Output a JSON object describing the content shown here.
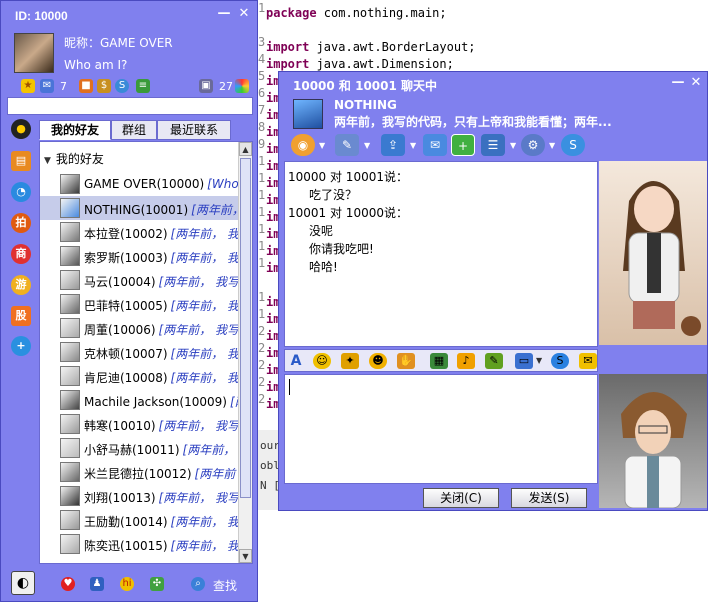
{
  "editor": {
    "lines": [
      {
        "kw": "package",
        "rest": " com.nothing.main;"
      },
      {
        "kw": "",
        "rest": ""
      },
      {
        "kw": "import",
        "rest": " java.awt.BorderLayout;"
      },
      {
        "kw": "import",
        "rest": " java.awt.Dimension;"
      },
      {
        "kw": "im",
        "rest": ""
      },
      {
        "kw": "im",
        "rest": ""
      },
      {
        "kw": "im",
        "rest": ""
      },
      {
        "kw": "im",
        "rest": ""
      },
      {
        "kw": "im",
        "rest": ""
      },
      {
        "kw": "im",
        "rest": ""
      },
      {
        "kw": "im",
        "rest": ""
      },
      {
        "kw": "im",
        "rest": ""
      },
      {
        "kw": "im",
        "rest": ""
      },
      {
        "kw": "im",
        "rest": ""
      },
      {
        "kw": "im",
        "rest": ""
      },
      {
        "kw": "im",
        "rest": ""
      },
      {
        "kw": "",
        "rest": ""
      },
      {
        "kw": "im",
        "rest": ""
      },
      {
        "kw": "im",
        "rest": ""
      },
      {
        "kw": "im",
        "rest": ""
      },
      {
        "kw": "im",
        "rest": ""
      },
      {
        "kw": "im",
        "rest": ""
      },
      {
        "kw": "im",
        "rest": ""
      },
      {
        "kw": "im",
        "rest": ""
      }
    ],
    "gutter": [
      "1",
      "",
      "3",
      "4",
      "5",
      "6",
      "7",
      "8",
      "9",
      "1",
      "1",
      "1",
      "1",
      "1",
      "1",
      "1",
      "",
      "1",
      "1",
      "2",
      "2",
      "2",
      "2",
      "2"
    ],
    "fragments": [
      "ourc",
      "obl",
      "N ["
    ]
  },
  "buddy_window": {
    "id_label": "ID: 10000",
    "minimize": "—",
    "close": "✕",
    "nickname_line": "昵称：GAME OVER",
    "signature": "Who am I?",
    "mail_count": "7",
    "visitor_count": "27",
    "tabs": [
      {
        "label": "我的好友",
        "active": true
      },
      {
        "label": "群组",
        "active": false
      },
      {
        "label": "最近联系",
        "active": false
      }
    ],
    "group_name": "我的好友",
    "buddies": [
      {
        "name": "GAME OVER(10000)",
        "sig": "[Who a",
        "sel": false
      },
      {
        "name": "NOTHING(10001)",
        "sig": "[两年前，",
        "sel": true
      },
      {
        "name": "本拉登(10002)",
        "sig": "[两年前，  我",
        "sel": false
      },
      {
        "name": "索罗斯(10003)",
        "sig": "[两年前，  我",
        "sel": false
      },
      {
        "name": "马云(10004)",
        "sig": "[两年前，  我写",
        "sel": false
      },
      {
        "name": "巴菲特(10005)",
        "sig": "[两年前，  我写",
        "sel": false
      },
      {
        "name": "周董(10006)",
        "sig": "[两年前，  我写",
        "sel": false
      },
      {
        "name": "克林顿(10007)",
        "sig": "[两年前，  我",
        "sel": false
      },
      {
        "name": "肯尼迪(10008)",
        "sig": "[两年前，  我",
        "sel": false
      },
      {
        "name": "Machile Jackson(10009)",
        "sig": "[两",
        "sel": false
      },
      {
        "name": "韩寒(10010)",
        "sig": "[两年前，  我写",
        "sel": false
      },
      {
        "name": "小舒马赫(10011)",
        "sig": "[两年前，",
        "sel": false
      },
      {
        "name": "米兰昆德拉(10012)",
        "sig": "[两年前",
        "sel": false
      },
      {
        "name": "刘翔(10013)",
        "sig": "[两年前，  我写",
        "sel": false
      },
      {
        "name": "王励勤(10014)",
        "sig": "[两年前，  我",
        "sel": false
      },
      {
        "name": "陈奕迅(10015)",
        "sig": "[两年前，  我",
        "sel": false
      }
    ],
    "side_icons": [
      "qq-penguin",
      "bookshelf",
      "globe",
      "拍",
      "商",
      "游",
      "股",
      "+"
    ],
    "find_label": "查找"
  },
  "chat_window": {
    "title": "10000 和 10001 聊天中",
    "minimize": "—",
    "close": "✕",
    "peer_nick": "NOTHING",
    "peer_sign": "两年前，我写的代码，只有上帝和我能看懂；两年...",
    "messages": [
      {
        "text": "10000 对 10001说：",
        "indent": false
      },
      {
        "text": "吃了没？",
        "indent": true
      },
      {
        "text": "10001 对 10000说：",
        "indent": false
      },
      {
        "text": "没呢",
        "indent": true
      },
      {
        "text": "你请我吃吧!",
        "indent": true
      },
      {
        "text": "哈哈!",
        "indent": true
      }
    ],
    "close_button": "关闭(C)",
    "send_button": "发送(S)"
  }
}
